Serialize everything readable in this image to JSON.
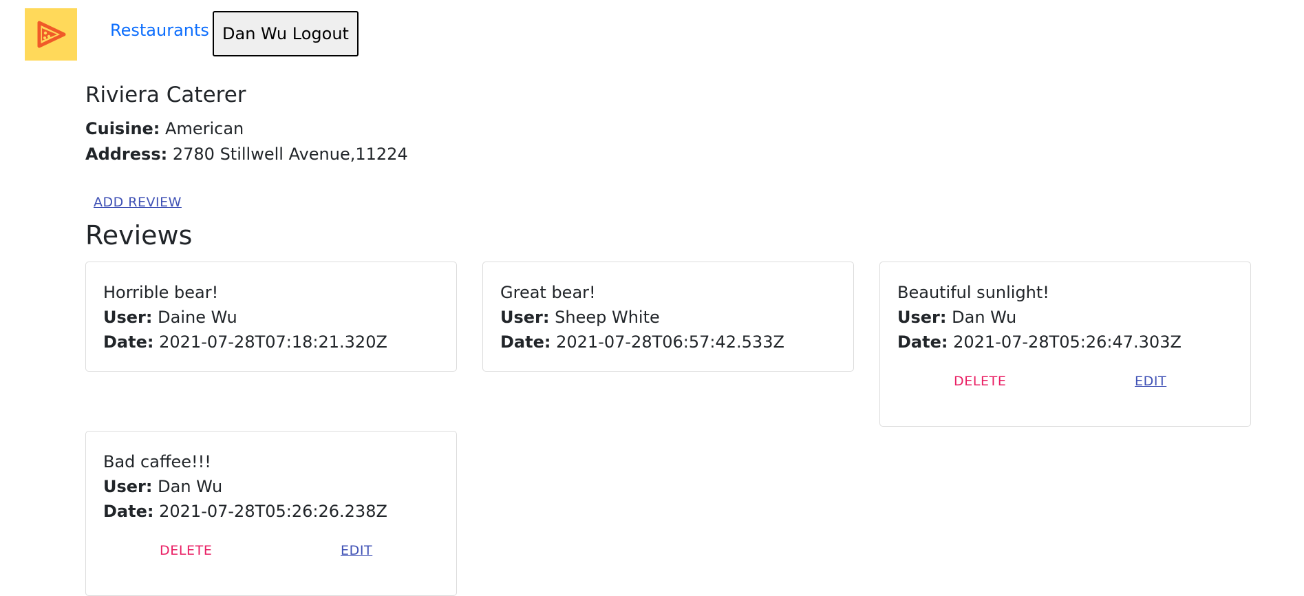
{
  "nav": {
    "logo_icon": "pizza-play-logo-icon",
    "restaurants_link": "Restaurants",
    "logout_button": "Dan Wu Logout"
  },
  "restaurant": {
    "name": "Riviera Caterer",
    "cuisine_label": "Cuisine:",
    "cuisine": "American",
    "address_label": "Address:",
    "address": "2780 Stillwell Avenue,11224"
  },
  "actions": {
    "add_review": "ADD REVIEW"
  },
  "reviews_title": "Reviews",
  "labels": {
    "user": "User:",
    "date": "Date:",
    "delete": "DELETE",
    "edit": "EDIT"
  },
  "reviews": [
    {
      "text": "Horrible bear!",
      "user": "Daine Wu",
      "date": "2021-07-28T07:18:21.320Z"
    },
    {
      "text": "Great bear!",
      "user": "Sheep White",
      "date": "2021-07-28T06:57:42.533Z"
    },
    {
      "text": "Beautiful sunlight!",
      "user": "Dan Wu",
      "date": "2021-07-28T05:26:47.303Z"
    },
    {
      "text": "Bad caffee!!!",
      "user": "Dan Wu",
      "date": "2021-07-28T05:26:26.238Z"
    }
  ],
  "colors": {
    "logo_bg": "#ffd95a",
    "link_blue": "#0d6efd",
    "delete_pink": "#e91e63",
    "edit_indigo": "#3f51b5"
  }
}
